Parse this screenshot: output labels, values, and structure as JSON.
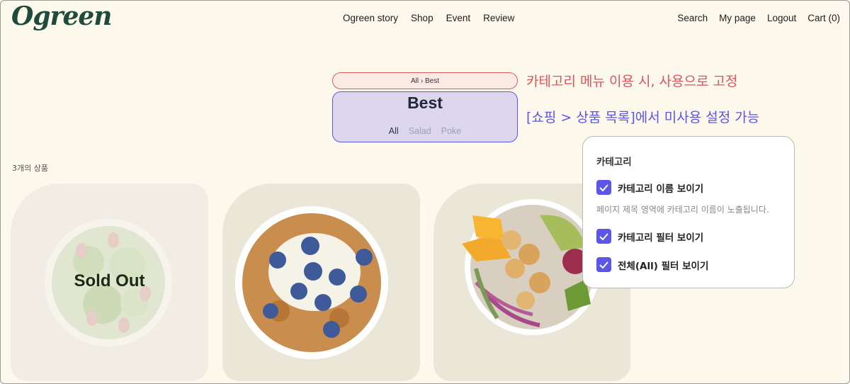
{
  "header": {
    "logo": "Ogreen",
    "nav": [
      "Ogreen story",
      "Shop",
      "Event",
      "Review"
    ],
    "utility": [
      "Search",
      "My page",
      "Logout",
      "Cart (0)"
    ]
  },
  "breadcrumb": "All › Best",
  "category": {
    "title": "Best",
    "filters": [
      "All",
      "Salad",
      "Poke"
    ],
    "active_filter": "All"
  },
  "annotations": {
    "red": "카테고리 메뉴 이용 시, 사용으로 고정",
    "blue": "[쇼핑 > 상품 목록]에서 미사용 설정 가능"
  },
  "product_count": "3개의 상품",
  "products": [
    {
      "status": "Sold Out",
      "image": "salad-bowl"
    },
    {
      "image": "granola-yogurt-blueberry-bowl"
    },
    {
      "image": "poke-bowl"
    }
  ],
  "settings_panel": {
    "title": "카테고리",
    "options": [
      {
        "label": "카테고리 이름 보이기",
        "checked": true,
        "description": "페이지 제목 영역에 카테고리 이름이 노출됩니다."
      },
      {
        "label": "카테고리 필터 보이기",
        "checked": true
      },
      {
        "label": "전체(All) 필터 보이기",
        "checked": true
      }
    ]
  },
  "colors": {
    "background": "#fdf8ec",
    "brand": "#1f4a3c",
    "accent": "#5b55e8",
    "annotation_red": "#e2535d"
  }
}
